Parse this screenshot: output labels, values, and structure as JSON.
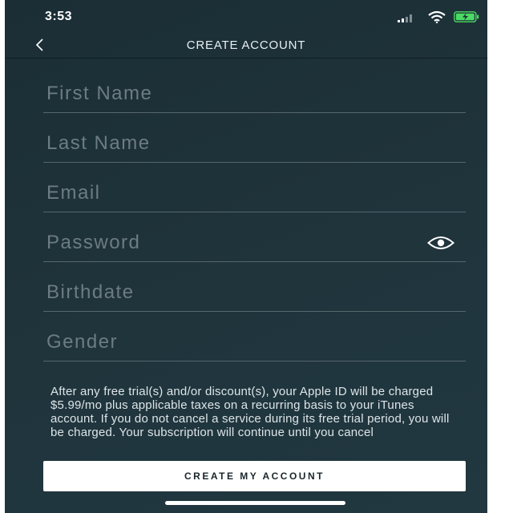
{
  "status_bar": {
    "time": "3:53",
    "icons": [
      "signal-icon",
      "wifi-icon",
      "battery-charging-icon"
    ],
    "battery_color": "#4cd964"
  },
  "nav": {
    "back_icon": "chevron-left-icon",
    "title": "CREATE ACCOUNT"
  },
  "form": {
    "first_name": {
      "placeholder": "First Name",
      "value": ""
    },
    "last_name": {
      "placeholder": "Last Name",
      "value": ""
    },
    "email": {
      "placeholder": "Email",
      "value": ""
    },
    "password": {
      "placeholder": "Password",
      "value": "",
      "toggle_icon": "eye-icon"
    },
    "birthdate": {
      "placeholder": "Birthdate",
      "value": ""
    },
    "gender": {
      "placeholder": "Gender",
      "value": ""
    }
  },
  "disclaimer": "After any free trial(s) and/or discount(s), your Apple ID will be charged $5.99/mo plus applicable taxes on a recurring basis to your iTunes account. If you do not cancel a service during its free trial period, you will be charged. Your subscription will continue until you cancel",
  "cta": {
    "label": "CREATE MY ACCOUNT"
  },
  "colors": {
    "background": "#1f3139",
    "divider": "#56666c",
    "placeholder": "#6d7c82",
    "button_bg": "#ffffff",
    "button_text": "#1a262c"
  }
}
